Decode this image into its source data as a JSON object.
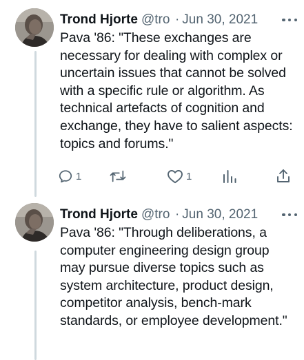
{
  "tweets": [
    {
      "author": "Trond Hjorte",
      "handle": "@tro",
      "separator": "·",
      "date": "Jun 30, 2021",
      "text": "Pava '86: \"These exchanges are necessary for dealing with complex or uncertain issues that cannot be solved with a specific rule or algorithm. As technical artefacts of cognition and exchange, they have to salient aspects: topics and forums.\"",
      "replies": "1",
      "likes": "1",
      "icons": [
        "reply-icon",
        "retweet-icon",
        "like-icon",
        "analytics-icon",
        "share-icon"
      ]
    },
    {
      "author": "Trond Hjorte",
      "handle": "@tro",
      "separator": "·",
      "date": "Jun 30, 2021",
      "text": "Pava '86: \"Through deliberations, a computer engineering design group may pursue diverse topics such as system architecture, product design, competitor analysis, bench-mark standards, or employee development.\""
    }
  ],
  "colors": {
    "text": "#0f1419",
    "secondary": "#536471",
    "thread_line": "#cfd9de",
    "background": "#ffffff"
  }
}
